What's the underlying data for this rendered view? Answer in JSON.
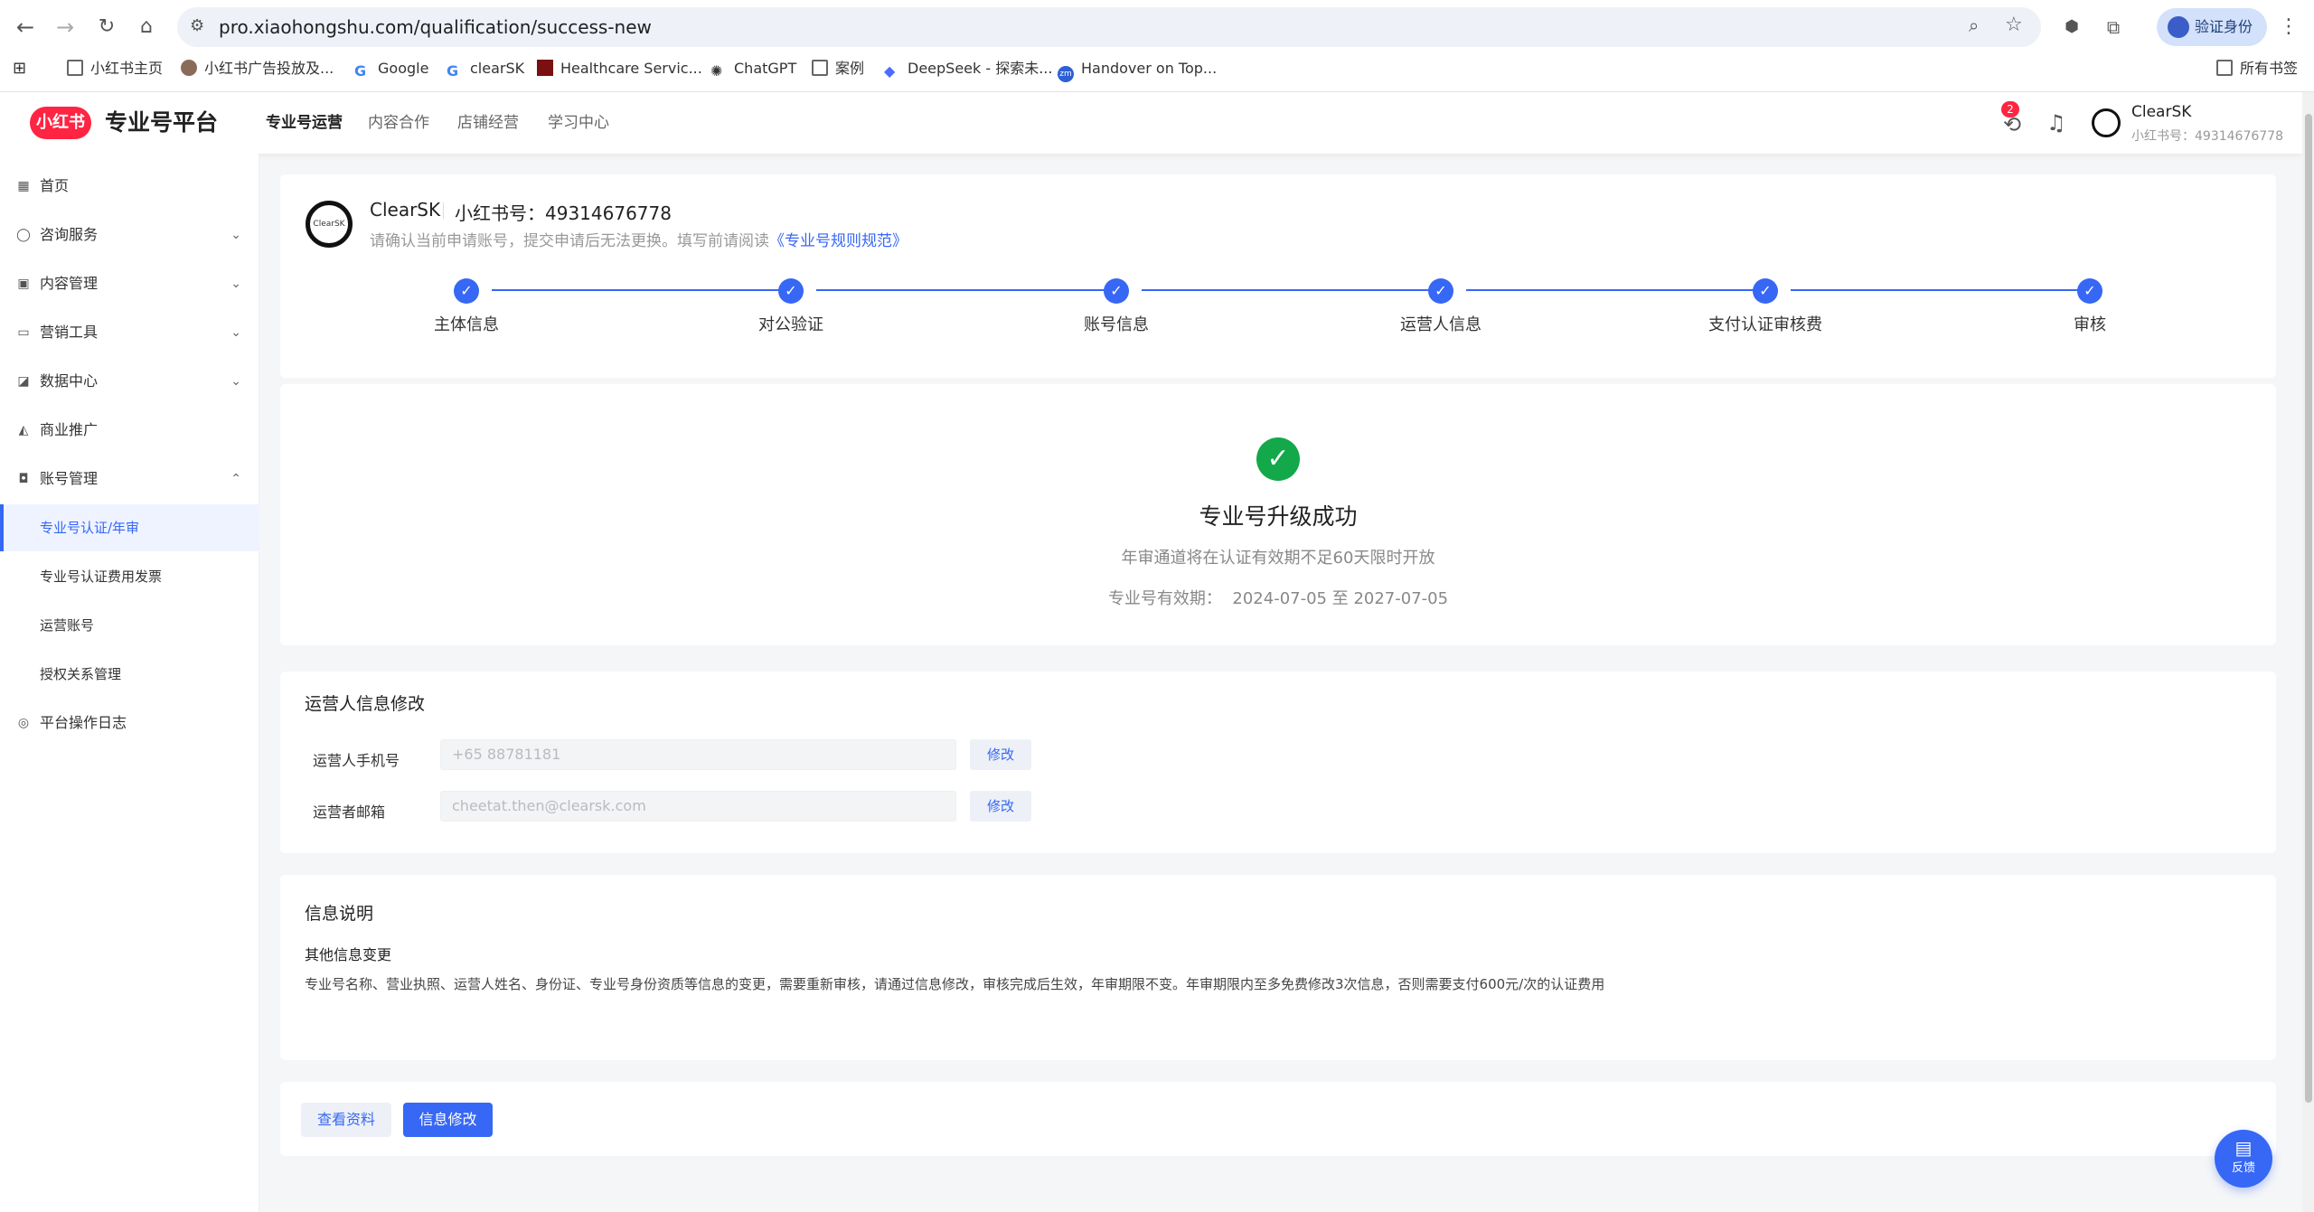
{
  "browser": {
    "url": "pro.xiaohongshu.com/qualification/success-new",
    "verify_label": "验证身份",
    "bookmarks": [
      {
        "label": "小红书主页",
        "icon": "folder-icon"
      },
      {
        "label": "小红书广告投放及...",
        "icon": "avatar-icon"
      },
      {
        "label": "Google",
        "icon": "google-icon"
      },
      {
        "label": "clearSK",
        "icon": "google-icon"
      },
      {
        "label": "Healthcare Servic...",
        "icon": "site-icon"
      },
      {
        "label": "ChatGPT",
        "icon": "chatgpt-icon"
      },
      {
        "label": "案例",
        "icon": "folder-icon"
      },
      {
        "label": "DeepSeek - 探索未...",
        "icon": "deepseek-icon"
      },
      {
        "label": "Handover on Top...",
        "icon": "zm-icon"
      }
    ],
    "all_bookmarks": "所有书签"
  },
  "header": {
    "logo": "小红书",
    "platform": "专业号平台",
    "nav": [
      "专业号运营",
      "内容合作",
      "店铺经营",
      "学习中心"
    ],
    "active_nav": "专业号运营",
    "notification_badge": "2",
    "user_name": "ClearSK",
    "user_id": "小红书号：49314676778"
  },
  "sidebar": {
    "items": [
      {
        "label": "首页",
        "icon": "grid-icon"
      },
      {
        "label": "咨询服务",
        "icon": "chat-icon",
        "expandable": true
      },
      {
        "label": "内容管理",
        "icon": "content-icon",
        "expandable": true
      },
      {
        "label": "营销工具",
        "icon": "tool-icon",
        "expandable": true
      },
      {
        "label": "数据中心",
        "icon": "chart-icon",
        "expandable": true
      },
      {
        "label": "商业推广",
        "icon": "promo-icon"
      },
      {
        "label": "账号管理",
        "icon": "account-icon",
        "expanded": true
      }
    ],
    "sub_items": [
      "专业号认证/年审",
      "专业号认证费用发票",
      "运营账号",
      "授权关系管理"
    ],
    "active_sub": "专业号认证/年审",
    "log": "平台操作日志"
  },
  "account": {
    "name": "ClearSK",
    "xhs_id": "小红书号：49314676778",
    "notice": "请确认当前申请账号，提交申请后无法更换。填写前请阅读",
    "rules_link": "《专业号规则规范》"
  },
  "steps": [
    "主体信息",
    "对公验证",
    "账号信息",
    "运营人信息",
    "支付认证审核费",
    "审核"
  ],
  "result": {
    "title": "专业号升级成功",
    "subtitle": "年审通道将在认证有效期不足60天限时开放",
    "validity_label": "专业号有效期：",
    "validity_range": "2024-07-05 至 2027-07-05"
  },
  "operator": {
    "title": "运营人信息修改",
    "phone_label": "运营人手机号",
    "phone_value": "+65 88781181",
    "email_label": "运营者邮箱",
    "email_value": "cheetat.then@clearsk.com",
    "edit_label": "修改"
  },
  "info": {
    "title": "信息说明",
    "subtitle": "其他信息变更",
    "text": "专业号名称、营业执照、运营人姓名、身份证、专业号身份资质等信息的变更，需要重新审核，请通过信息修改，审核完成后生效，年审期限不变。年审期限内至多免费修改3次信息，否则需要支付600元/次的认证费用"
  },
  "actions": {
    "view_label": "查看资料",
    "edit_label": "信息修改"
  },
  "feedback": "反馈",
  "colors": {
    "accent": "#3767f5",
    "brand": "#ff2442",
    "success": "#13a84a"
  }
}
